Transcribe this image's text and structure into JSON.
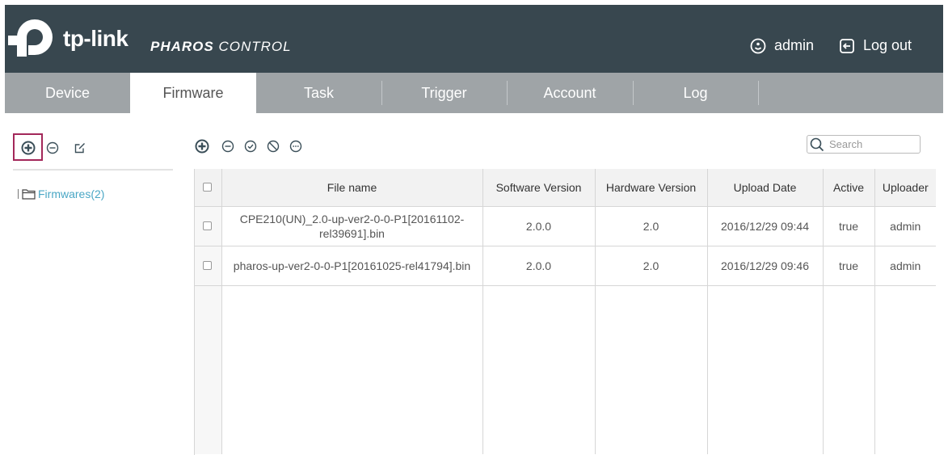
{
  "brand": {
    "logo_text": "tp-link",
    "product_strong": "PHAROS",
    "product_light": " CONTROL"
  },
  "header": {
    "user_label": "admin",
    "logout_label": "Log out"
  },
  "tabs": [
    {
      "label": "Device",
      "active": false
    },
    {
      "label": "Firmware",
      "active": true
    },
    {
      "label": "Task",
      "active": false
    },
    {
      "label": "Trigger",
      "active": false
    },
    {
      "label": "Account",
      "active": false
    },
    {
      "label": "Log",
      "active": false
    }
  ],
  "left_toolbar": {
    "icons": [
      "add-icon",
      "remove-icon",
      "edit-icon"
    ]
  },
  "tree": {
    "root_label": "Firmwares(2)"
  },
  "toolbar": {
    "icons": [
      "add-icon",
      "remove-icon",
      "enable-icon",
      "disable-icon",
      "more-icon"
    ]
  },
  "search": {
    "placeholder": "Search",
    "value": ""
  },
  "table": {
    "columns": [
      "File name",
      "Software Version",
      "Hardware Version",
      "Upload Date",
      "Active",
      "Uploader"
    ],
    "rows": [
      {
        "file_name": "CPE210(UN)_2.0-up-ver2-0-0-P1[20161102-rel39691].bin",
        "software_version": "2.0.0",
        "hardware_version": "2.0",
        "upload_date": "2016/12/29 09:44",
        "active": "true",
        "uploader": "admin"
      },
      {
        "file_name": "pharos-up-ver2-0-0-P1[20161025-rel41794].bin",
        "software_version": "2.0.0",
        "hardware_version": "2.0",
        "upload_date": "2016/12/29 09:46",
        "active": "true",
        "uploader": "admin"
      }
    ]
  },
  "colors": {
    "header_bg": "#38474f",
    "tab_bar_bg": "#9fa4a7",
    "link": "#4aa7c5",
    "icon": "#3b4f59",
    "highlight": "#a3285a"
  }
}
